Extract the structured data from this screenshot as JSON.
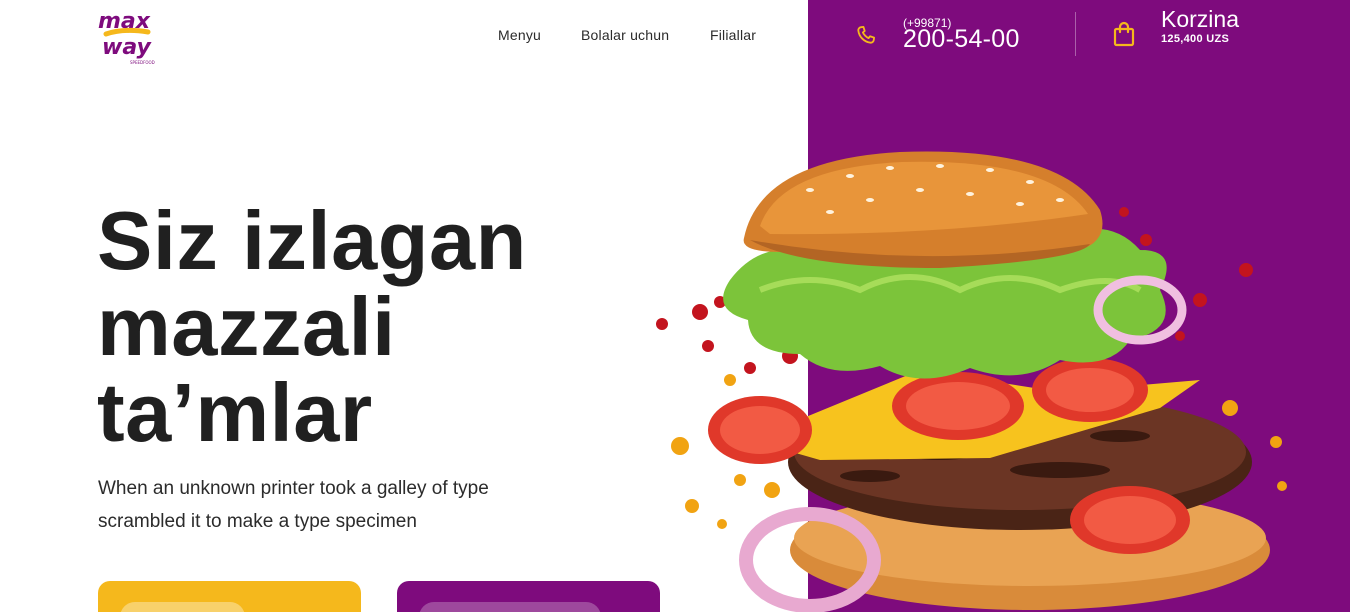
{
  "brand": {
    "logo_line1": "max",
    "logo_line2": "way",
    "logo_tagline": "SPEEDFOOD",
    "purple": "#7e0b7d",
    "yellow": "#f5b81c"
  },
  "nav": {
    "items": [
      {
        "label": "Menyu"
      },
      {
        "label": "Bolalar uchun"
      },
      {
        "label": "Filiallar"
      }
    ]
  },
  "contact": {
    "icon": "phone-icon",
    "prefix": "(+99871)",
    "number": "200-54-00"
  },
  "cart": {
    "icon": "shopping-bag-icon",
    "label": "Korzina",
    "total": "125,400 UZS"
  },
  "hero": {
    "title_lines": [
      "Siz izlagan",
      "mazzali",
      "ta’mlar"
    ],
    "description": "When an unknown printer took a galley of type scrambled it to make a type specimen"
  }
}
